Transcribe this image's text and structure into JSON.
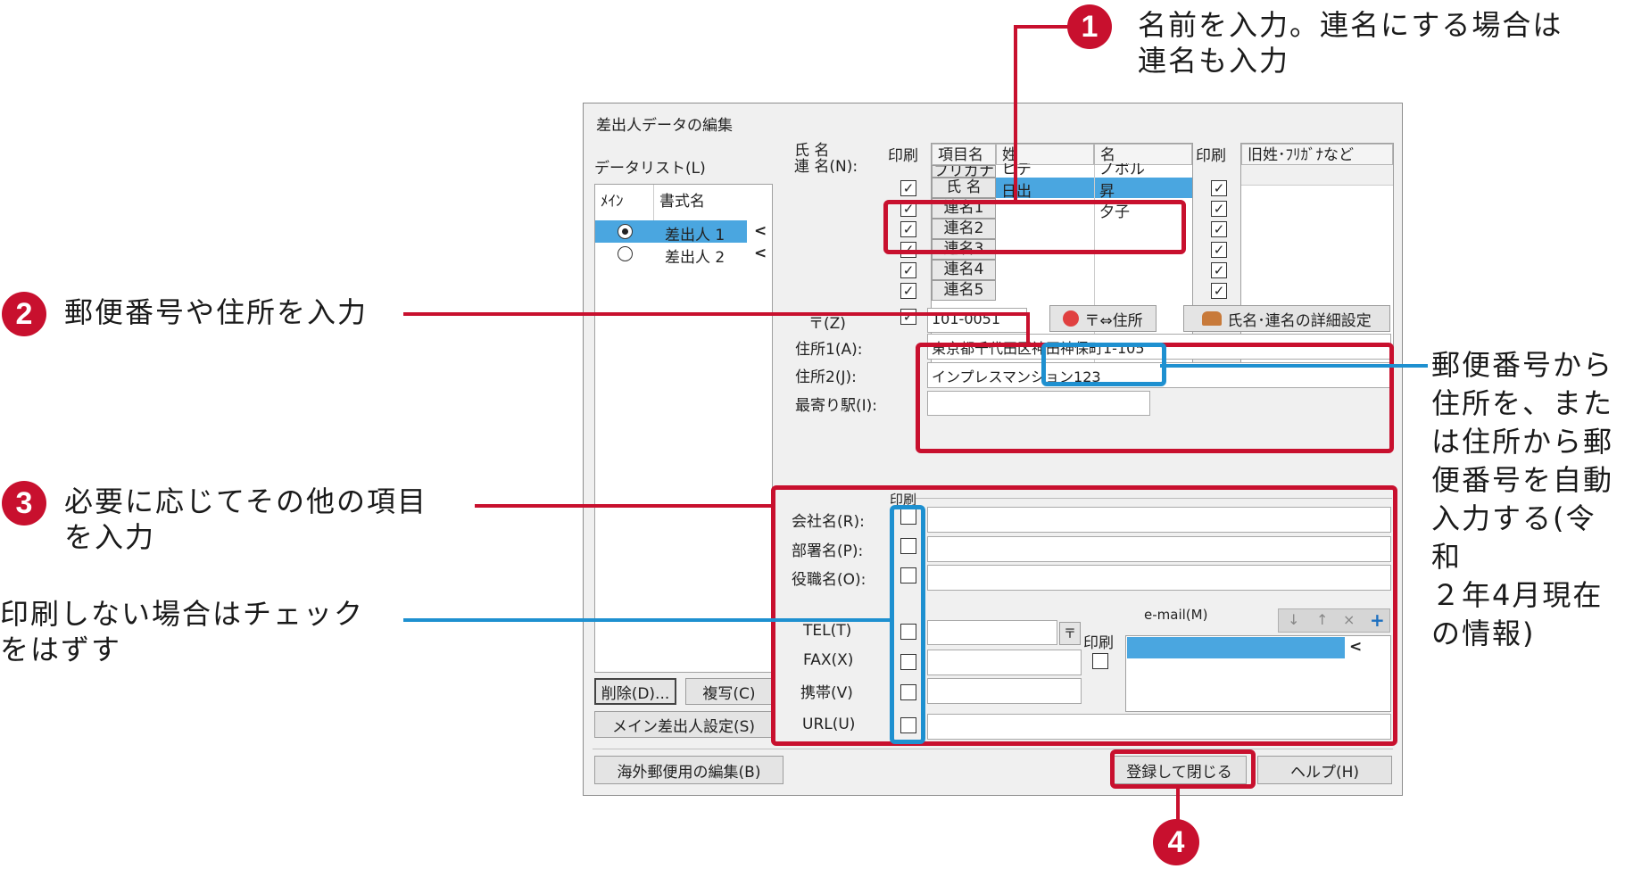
{
  "callouts": {
    "c1": {
      "num": "1",
      "text": "名前を入力。連名にする場合は\n連名も入力"
    },
    "c2": {
      "num": "2",
      "text": "郵便番号や住所を入力"
    },
    "c3": {
      "num": "3",
      "text": "必要に応じてその他の項目\nを入力"
    },
    "c_uncheck": {
      "text": "印刷しない場合はチェック\nをはずす"
    },
    "c_right": {
      "text": "郵便番号から\n住所を、また\nは住所から郵\n便番号を自動\n入力する(令和\n２年4月現在\nの情報)"
    },
    "c4": {
      "num": "4"
    }
  },
  "window": {
    "title": "差出人データの編集",
    "datalist": {
      "label": "データリスト(L)",
      "col_main": "ﾒｲﾝ",
      "col_name": "書式名",
      "rows": [
        {
          "name": "差出人 1",
          "selected": true
        },
        {
          "name": "差出人 2",
          "selected": false
        }
      ],
      "arrow": "<"
    },
    "name_section": {
      "label": "氏 名\n連 名(N):",
      "print_header": "印刷",
      "col_item": "項目名",
      "col_sei": "姓",
      "col_mei": "名",
      "furigana_row": {
        "item": "フリガナ",
        "sei": "ヒデ",
        "mei": "ノボル"
      },
      "rows": [
        {
          "item": "氏 名",
          "sei": "日出",
          "mei": "昇",
          "checked": true
        },
        {
          "item": "連名1",
          "sei": "",
          "mei": "夕子",
          "checked": true
        },
        {
          "item": "連名2",
          "sei": "",
          "mei": "",
          "checked": true
        },
        {
          "item": "連名3",
          "sei": "",
          "mei": "",
          "checked": true
        },
        {
          "item": "連名4",
          "sei": "",
          "mei": "",
          "checked": true
        },
        {
          "item": "連名5",
          "sei": "",
          "mei": "",
          "checked": true
        }
      ],
      "print_header2": "印刷",
      "col_old": "旧姓･ﾌﾘｶﾞﾅなど"
    },
    "address": {
      "zip_label": "〒(Z)",
      "zip_value": "101-0051",
      "zip_convert_button": "〒⇔住所",
      "detail_button": "氏名･連名の詳細設定",
      "addr1_label": "住所1(A):",
      "addr1_value": "東京都千代田区神田神保町1-105",
      "addr2_label": "住所2(J):",
      "addr2_value": "インプレスマンション123",
      "station_label": "最寄り駅(I):",
      "station_value": ""
    },
    "other": {
      "print_header": "印刷",
      "company_label": "会社名(R):",
      "dept_label": "部署名(P):",
      "title_label": "役職名(O):",
      "tel_label": "TEL(T)",
      "fax_label": "FAX(X)",
      "mobile_label": "携帯(V)",
      "url_label": "URL(U)",
      "email_label": "e-mail(M)",
      "email_print": "印刷",
      "email_arrow": "<"
    },
    "buttons": {
      "delete": "削除(D)...",
      "copy": "複写(C)",
      "main_sender": "メイン差出人設定(S)",
      "overseas": "海外郵便用の編集(B)",
      "register_close": "登録して閉じる",
      "help": "ヘルプ(H)"
    }
  },
  "colors": {
    "accent_red": "#c8102e",
    "accent_blue": "#1e90d0",
    "selection": "#4aa6e0"
  }
}
